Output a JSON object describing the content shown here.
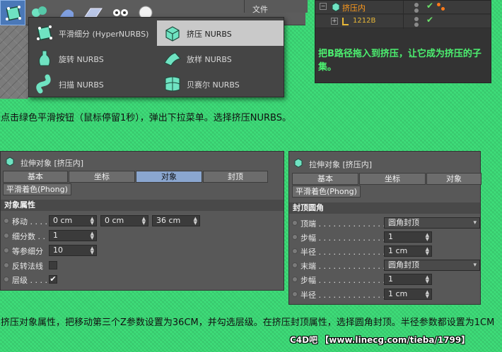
{
  "toolbar": {
    "menu_file": "文件"
  },
  "dropdown": {
    "items": [
      {
        "label": "平滑细分 (HyperNURBS)"
      },
      {
        "label": "挤压 NURBS"
      },
      {
        "label": "旋转 NURBS"
      },
      {
        "label": "放样 NURBS"
      },
      {
        "label": "扫描 NURBS"
      },
      {
        "label": "贝赛尔 NURBS"
      }
    ]
  },
  "object_manager": {
    "rows": [
      {
        "name": "挤压内"
      },
      {
        "name": "1212B"
      }
    ],
    "note": "把B路径拖入到挤压，让它成为挤压的子集。"
  },
  "captions": {
    "top": "点击绿色平滑按钮（鼠标停留1秒），弹出下拉菜单。选择挤压NURBS。",
    "bottom": "挤压对象属性，把移动第三个Z参数设置为36CM，并勾选层级。在挤压封顶属性，选择圆角封顶。半径参数都设置为1CM"
  },
  "panel_left": {
    "title": "拉伸对象 [挤压内]",
    "tabs": [
      "基本",
      "坐标",
      "对象",
      "封顶"
    ],
    "selected_tab": "对象",
    "phong": "平滑着色(Phong)",
    "section": "对象属性",
    "move": {
      "label": "移动 . . . .",
      "x": "0 cm",
      "y": "0 cm",
      "z": "36 cm"
    },
    "subdiv": {
      "label": "细分数 . .",
      "value": "1"
    },
    "isoparm": {
      "label": "等参细分",
      "value": "10"
    },
    "flip_normals": {
      "label": "反转法线",
      "checked": false
    },
    "hierarchical": {
      "label": "层级 . . . .",
      "checked": true,
      "mark": "✔"
    }
  },
  "panel_right": {
    "title": "拉伸对象 [挤压内]",
    "tabs": [
      "基本",
      "坐标",
      "对象"
    ],
    "phong": "平滑着色(Phong)",
    "section": "封顶圆角",
    "rows": [
      {
        "label": "顶端 . . . . . . . . . . . . . .",
        "value": "圆角封顶",
        "type": "dropdown"
      },
      {
        "label": "步幅 . . . . . . . . . . . . . .",
        "value": "1",
        "type": "number"
      },
      {
        "label": "半径 . . . . . . . . . . . . . .",
        "value": "1 cm",
        "type": "number"
      },
      {
        "label": "末端 . . . . . . . . . . . . . .",
        "value": "圆角封顶",
        "type": "dropdown"
      },
      {
        "label": "步幅 . . . . . . . . . . . . . .",
        "value": "1",
        "type": "number"
      },
      {
        "label": "半径 . . . . . . . . . . . . . .",
        "value": "1 cm",
        "type": "number"
      }
    ]
  },
  "watermark": "C4D吧 【www.linecg.com/tieba/1799】",
  "colors": {
    "background": "#3fe07b",
    "accent_blue": "#8aa6cf",
    "icon_teal": "#6fe3c2",
    "orange": "#ff9a1c",
    "note_green": "#4cf070"
  }
}
